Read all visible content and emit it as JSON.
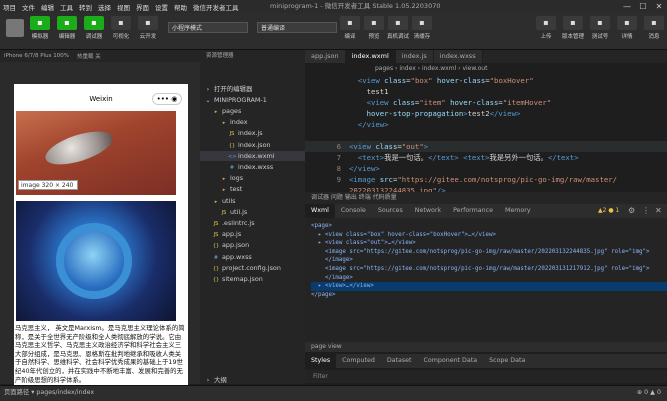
{
  "menu": [
    "项目",
    "文件",
    "编辑",
    "工具",
    "转到",
    "选择",
    "视图",
    "界面",
    "设置",
    "帮助",
    "微信开发者工具"
  ],
  "window_title": "miniprogram-1 - 微信开发者工具 Stable 1.05.2203070",
  "window_controls": [
    "—",
    "☐",
    "✕"
  ],
  "toolbar": {
    "left_buttons": [
      {
        "label": "模拟器",
        "icon": "phone-icon",
        "on": true
      },
      {
        "label": "编辑器",
        "icon": "code-icon",
        "on": true
      },
      {
        "label": "调试器",
        "icon": "debug-icon",
        "on": true
      },
      {
        "label": "可视化",
        "icon": "eye-icon",
        "on": false
      },
      {
        "label": "云开发",
        "icon": "cloud-icon",
        "on": false
      }
    ],
    "mode_select": "小程序模式",
    "compile_select": "普通编译",
    "mid_buttons": [
      "编译",
      "预览",
      "真机调试",
      "清缓存"
    ],
    "right_buttons": [
      "上传",
      "版本管理",
      "测试号",
      "详情",
      "消息"
    ]
  },
  "simulator": {
    "device": "iPhone 6/7/8 Plus 100%",
    "status": "热重载 关",
    "nav_title": "Weixin",
    "capsule": "••• ◉",
    "tooltip": "image  320 × 240",
    "text": "马克思主义，                              英文是Marxism。是马克思主义理论体系的简称，是关于全世界无产阶级和全人类彻底解放的学说。它由马克思主义哲学、马克思主义政治经济学和科学社会主义三大部分组成，是马克思、恩格斯在批判地继承和吸收人类关于自然科学、思维科学、社会科学优秀成果的基础上于19世纪40年代创立的，并在实践中不断地丰富、发展和完善的无产阶级思想的科学体系。"
  },
  "explorer": {
    "header": "资源管理器",
    "open_editors": "打开的编辑器",
    "project": "MINIPROGRAM-1",
    "items": [
      {
        "name": "pages",
        "type": "folder",
        "level": 1
      },
      {
        "name": "index",
        "type": "folder",
        "level": 2
      },
      {
        "name": "index.js",
        "type": "js",
        "level": 3
      },
      {
        "name": "index.json",
        "type": "json",
        "level": 3
      },
      {
        "name": "index.wxml",
        "type": "wxml",
        "level": 3,
        "selected": true
      },
      {
        "name": "index.wxss",
        "type": "wxss",
        "level": 3
      },
      {
        "name": "logs",
        "type": "folder",
        "level": 2
      },
      {
        "name": "test",
        "type": "folder",
        "level": 2
      },
      {
        "name": "utils",
        "type": "folder",
        "level": 1
      },
      {
        "name": "util.js",
        "type": "js",
        "level": 2
      },
      {
        "name": ".eslintrc.js",
        "type": "js",
        "level": 1
      },
      {
        "name": "app.js",
        "type": "js",
        "level": 1
      },
      {
        "name": "app.json",
        "type": "json",
        "level": 1
      },
      {
        "name": "app.wxss",
        "type": "wxss",
        "level": 1
      },
      {
        "name": "project.config.json",
        "type": "json",
        "level": 1
      },
      {
        "name": "sitemap.json",
        "type": "json",
        "level": 1
      }
    ],
    "outline": "大纲"
  },
  "editor": {
    "tabs": [
      {
        "label": "app.json",
        "active": false
      },
      {
        "label": "index.wxml",
        "active": true
      },
      {
        "label": "index.js",
        "active": false
      },
      {
        "label": "index.wxss",
        "active": false
      }
    ],
    "breadcrumb": "pages › index › index.wxml › view.out",
    "lines": [
      {
        "n": "",
        "html": "  <span class=\"tg\">&lt;view</span> <span class=\"at\">class</span>=<span class=\"sv\">\"box\"</span> <span class=\"at\">hover-class</span>=<span class=\"sv\">\"boxHover\"</span>"
      },
      {
        "n": "",
        "html": "    test1"
      },
      {
        "n": "",
        "html": "    <span class=\"tg\">&lt;view</span> <span class=\"at\">class</span>=<span class=\"sv\">\"item\"</span> <span class=\"at\">hover-class</span>=<span class=\"sv\">\"itemHover\"</span>"
      },
      {
        "n": "",
        "html": "    <span class=\"at\">hover-stop-propagation</span><span class=\"tg\">&gt;</span>test2<span class=\"tg\">&lt;/view&gt;</span>"
      },
      {
        "n": "",
        "html": "  <span class=\"tg\">&lt;/view&gt;</span>"
      },
      {
        "n": "",
        "html": ""
      },
      {
        "n": "6",
        "html": "<span class=\"tg\">&lt;view</span> <span class=\"at\">class</span>=<span class=\"sv\">\"out\"</span><span class=\"tg\">&gt;</span>",
        "hl": true
      },
      {
        "n": "7",
        "html": "  <span class=\"tg\">&lt;text&gt;</span>我是一句话。<span class=\"tg\">&lt;/text&gt;</span> <span class=\"tg\">&lt;text&gt;</span>我是另外一句话。<span class=\"tg\">&lt;/text&gt;</span>"
      },
      {
        "n": "8",
        "html": "<span class=\"tg\">&lt;/view&gt;</span>"
      },
      {
        "n": "9",
        "html": "<span class=\"tg\">&lt;image</span> <span class=\"at\">src</span>=<span class=\"sv\">\"https://gitee.com/notsprog/pic-go-img/raw/master/</span>"
      },
      {
        "n": "",
        "html": "<span class=\"sv\">202203132244835.jpg\"</span><span class=\"tg\">/&gt;</span>"
      }
    ]
  },
  "devtools": {
    "header": "调试器  问题  输出  终端  代码质量",
    "tabs": [
      "Wxml",
      "Console",
      "Sources",
      "Network",
      "Performance",
      "Memory"
    ],
    "badges": "▲2 ● 1",
    "dom_lines": [
      "<page>",
      "  ▸ <view class=\"box\" hover-class=\"boxHover\">…</view>",
      "  ▸ <view class=\"out\">…</view>",
      "    <image src=\"https://gitee.com/notsprog/pic-go-img/raw/master/202203132244835.jpg\" role=\"img\">",
      "    </image>",
      "    <image src=\"https://gitee.com/notsprog/pic-go-img/raw/master/202203131217912.jpg\" role=\"img\">",
      "    </image>",
      "  ▸ <view>…</view>",
      "</page>"
    ],
    "selected_dom_line": 7,
    "path": "page  view",
    "sub_tabs": [
      "Styles",
      "Computed",
      "Dataset",
      "Component Data",
      "Scope Data"
    ],
    "filter": "Filter"
  },
  "statusbar": {
    "path": "页面路径 ▾  pages/index/index",
    "right": "⊕ 0 ▲ 0"
  }
}
